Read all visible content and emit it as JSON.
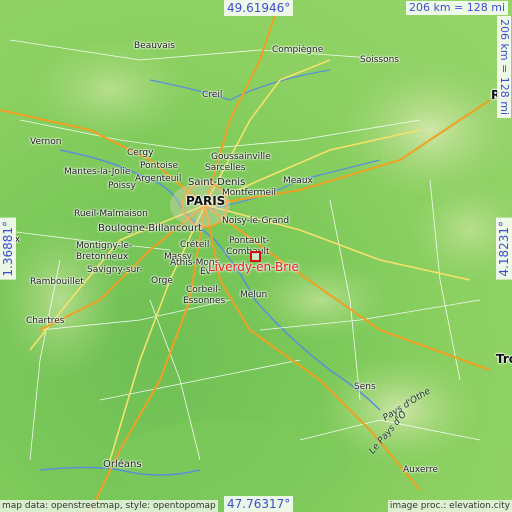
{
  "map": {
    "target": "Liverdy-en-Brie",
    "colors": {
      "terrain_low": "#6fbf55",
      "terrain_high": "#cfe3a8",
      "highway": "#f0a020",
      "trunk": "#f6e26a",
      "road": "#ffffff",
      "river": "#5a8fd8",
      "label_accent": "#3a4fd0",
      "target": "#e02020"
    }
  },
  "coords": {
    "top": "49.61946°",
    "bottom": "47.76317°",
    "left": "1.36881°",
    "right": "4.18231°"
  },
  "scale": {
    "horizontal": "206 km = 128 mi",
    "vertical": "206 km = 128 mi"
  },
  "cities": {
    "beauvais": "Beauvais",
    "compiegne": "Compiègne",
    "soissons": "Soissons",
    "creil": "Creil",
    "reims": "R",
    "vernon": "Vernon",
    "goussainville": "Goussainville",
    "sarcelles": "Sarcelles",
    "cergy": "Cergy",
    "pontoise": "Pontoise",
    "mantes": "Mantes-la-Jolie",
    "argenteuil": "Argenteuil",
    "poissy": "Poissy",
    "saint_denis": "Saint-Denis",
    "meaux": "Meaux",
    "montfermeil": "Montfermeil",
    "paris": "PARIS",
    "rueil": "Rueil-Malmaison",
    "noisy": "Noisy-le-Grand",
    "dreux": "reux",
    "boulogne": "Boulogne-Billancourt",
    "montigny": "Montigny-le-",
    "bretonneux": "Bretonneux",
    "creteil": "Créteil",
    "pontault": "Pontault-",
    "combault": "Combault",
    "massy": "Massy",
    "savigny": "Savigny-sur-",
    "orge": "Orge",
    "athis": "Athis-Mons",
    "evry": "Év",
    "rambouillet": "Rambouillet",
    "corbeil": "Corbeil-",
    "essonnes": "Essonnes",
    "melun": "Melun",
    "chartres": "Chartres",
    "troyes": "Tro",
    "sens": "Sens",
    "orleans": "Orléans",
    "auxerre": "Auxerre"
  },
  "regions": {
    "pays_othe": "Pays d'Othe",
    "pays_loise": "Le Pays d'O"
  },
  "credits": {
    "left": "map data: openstreetmap, style: opentopomap",
    "right": "image proc.: elevation.city"
  }
}
